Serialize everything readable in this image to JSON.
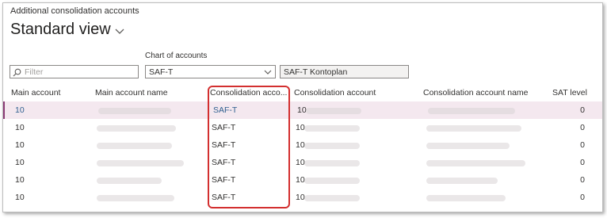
{
  "breadcrumb": "Additional consolidation accounts",
  "view_title": "Standard view",
  "filter_placeholder": "Filter",
  "chart_of_accounts": {
    "label": "Chart of accounts",
    "value": "SAF-T",
    "name": "SAF-T Kontoplan"
  },
  "columns": {
    "main_account": "Main account",
    "main_account_name": "Main account name",
    "consolidation_chart": "Consolidation acco...",
    "consolidation_account": "Consolidation account",
    "consolidation_account_name": "Consolidation account name",
    "sat_level": "SAT level"
  },
  "rows": [
    {
      "main_account": "10",
      "consolidation_chart": "SAF-T",
      "consolidation_account": "10",
      "sat_level": "0"
    },
    {
      "main_account": "10",
      "consolidation_chart": "SAF-T",
      "consolidation_account": "10",
      "sat_level": "0"
    },
    {
      "main_account": "10",
      "consolidation_chart": "SAF-T",
      "consolidation_account": "10",
      "sat_level": "0"
    },
    {
      "main_account": "10",
      "consolidation_chart": "SAF-T",
      "consolidation_account": "10",
      "sat_level": "0"
    },
    {
      "main_account": "10",
      "consolidation_chart": "SAF-T",
      "consolidation_account": "10",
      "sat_level": "0"
    },
    {
      "main_account": "10",
      "consolidation_chart": "SAF-T",
      "consolidation_account": "10",
      "sat_level": "0"
    }
  ],
  "colors": {
    "selected_row": "#f4e8ef",
    "selected_marker": "#8a3a74",
    "link": "#2f5f8f",
    "highlight_box": "#d32f2f"
  }
}
